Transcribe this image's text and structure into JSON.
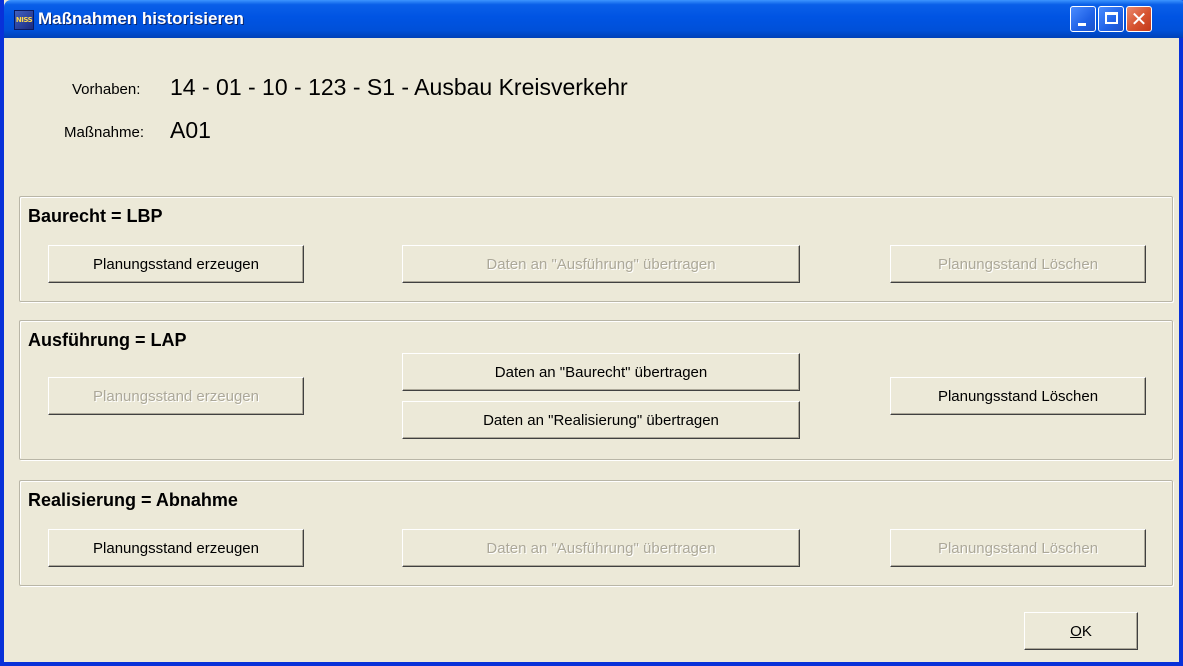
{
  "window": {
    "title": "Maßnahmen historisieren",
    "app_icon_text": "NISS"
  },
  "info": {
    "vorhaben_label": "Vorhaben:",
    "vorhaben_value": "14 - 01 - 10 - 123 - S1 - Ausbau Kreisverkehr",
    "massnahme_label": "Maßnahme:",
    "massnahme_value": "A01"
  },
  "groups": [
    {
      "title": "Baurecht = LBP",
      "buttons": [
        {
          "label": "Planungsstand erzeugen",
          "enabled": true
        },
        {
          "label": "Daten an \"Ausführung\" übertragen",
          "enabled": false
        },
        {
          "label": "Planungsstand Löschen",
          "enabled": false
        }
      ]
    },
    {
      "title": "Ausführung = LAP",
      "buttons": [
        {
          "label": "Planungsstand erzeugen",
          "enabled": false
        },
        {
          "label": "Daten an \"Baurecht\" übertragen",
          "enabled": true
        },
        {
          "label": "Daten an \"Realisierung\" übertragen",
          "enabled": true
        },
        {
          "label": "Planungsstand Löschen",
          "enabled": true
        }
      ]
    },
    {
      "title": "Realisierung = Abnahme",
      "buttons": [
        {
          "label": "Planungsstand erzeugen",
          "enabled": true
        },
        {
          "label": "Daten an \"Ausführung\" übertragen",
          "enabled": false
        },
        {
          "label": "Planungsstand Löschen",
          "enabled": false
        }
      ]
    }
  ],
  "footer": {
    "ok_label": "OK",
    "ok_mnemonic": "O",
    "ok_rest": "K"
  }
}
